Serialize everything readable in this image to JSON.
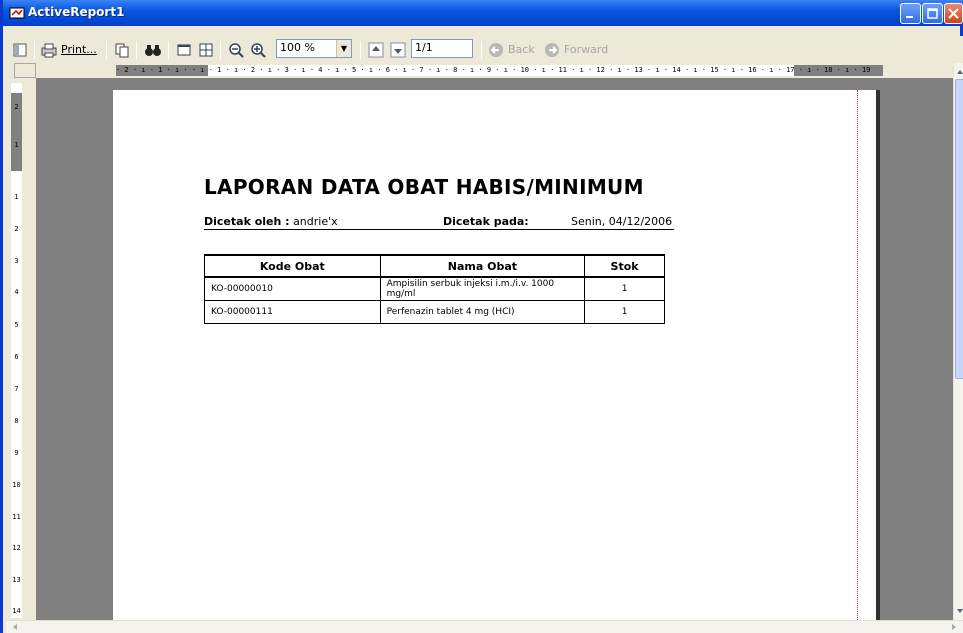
{
  "window": {
    "title": "ActiveReport1"
  },
  "toolbar": {
    "print_label": "Print...",
    "zoom_value": "100 %",
    "page_value": "1/1",
    "back_label": "Back",
    "forward_label": "Forward"
  },
  "ruler": {
    "horizontal_text": "· 2 · ı · 1 · ı ·  · ı · 1 · ı · 2 · ı · 3 · ı · 4 · ı · 5 · ı · 6 · ı · 7 · ı · 8 · ı · 9 · ı · 10 · ı · 11 · ı · 12 · ı · 13 · ı · 14 · ı · 15 · ı · 16 · ı · 17 · ı · 18 · ı · 19",
    "vertical_labels": [
      "2",
      "1",
      "1",
      "2",
      "3",
      "4",
      "5",
      "6",
      "7",
      "8",
      "9",
      "10",
      "11",
      "12",
      "13",
      "14"
    ]
  },
  "report": {
    "title": "LAPORAN DATA OBAT HABIS/MINIMUM",
    "printed_by_label": "Dicetak oleh :",
    "printed_by_value": "andrie'x",
    "printed_on_label": "Dicetak pada:",
    "printed_on_value": "Senin, 04/12/2006",
    "columns": [
      "Kode Obat",
      "Nama Obat",
      "Stok"
    ],
    "rows": [
      {
        "kode": "KO-00000010",
        "nama": "Ampisilin serbuk injeksi i.m./i.v. 1000 mg/ml",
        "stok": "1"
      },
      {
        "kode": "KO-00000111",
        "nama": "Perfenazin tablet 4 mg (HCI)",
        "stok": "1"
      }
    ]
  }
}
